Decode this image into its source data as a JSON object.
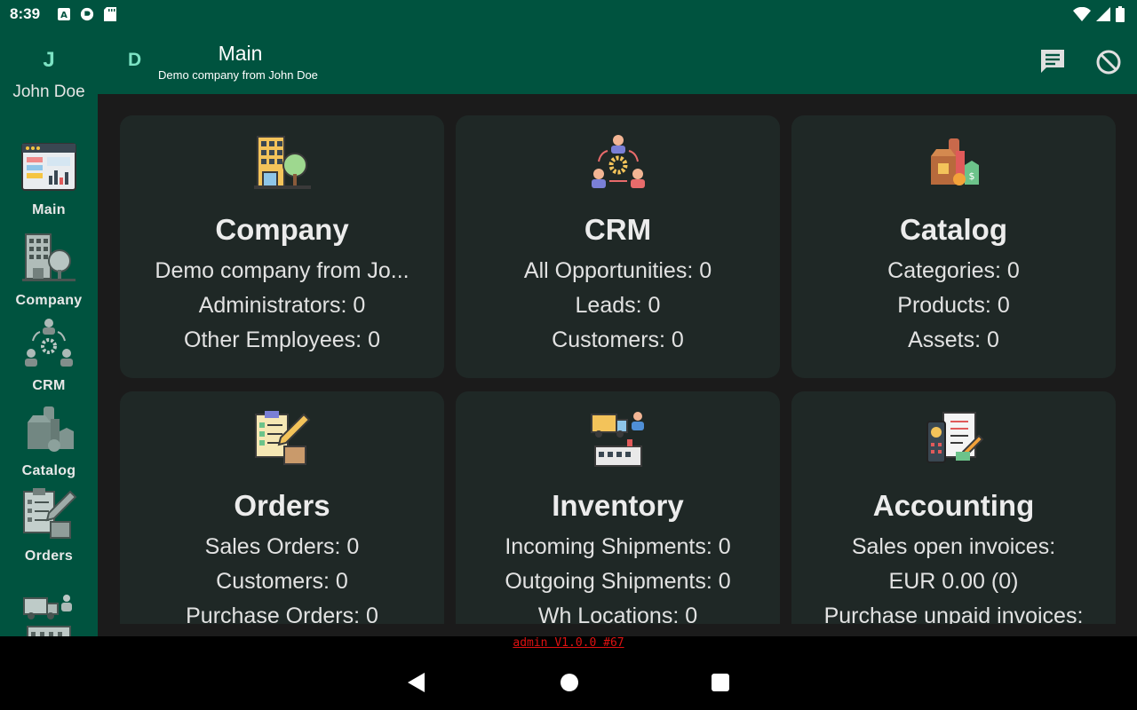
{
  "status_bar": {
    "time": "8:39"
  },
  "rail": {
    "user_initial": "J",
    "user_name": "John Doe",
    "items": [
      {
        "label": "Main",
        "icon": "dashboard-icon"
      },
      {
        "label": "Company",
        "icon": "building-icon"
      },
      {
        "label": "CRM",
        "icon": "people-network-icon"
      },
      {
        "label": "Catalog",
        "icon": "products-icon"
      },
      {
        "label": "Orders",
        "icon": "order-checklist-icon"
      },
      {
        "label": "",
        "icon": "inventory-truck-icon"
      }
    ]
  },
  "appbar": {
    "company_initial": "D",
    "title": "Main",
    "subtitle": "Demo company from John Doe",
    "chat_icon": "chat-icon",
    "block_icon": "block-icon"
  },
  "cards": [
    {
      "title": "Company",
      "icon": "building-icon",
      "lines": [
        "Demo company from Jo...",
        "Administrators: 0",
        "Other Employees: 0"
      ]
    },
    {
      "title": "CRM",
      "icon": "people-network-icon",
      "lines": [
        "All Opportunities: 0",
        "Leads: 0",
        "Customers: 0"
      ]
    },
    {
      "title": "Catalog",
      "icon": "products-icon",
      "lines": [
        "Categories: 0",
        "Products: 0",
        "Assets: 0"
      ]
    },
    {
      "title": "Orders",
      "icon": "order-checklist-icon",
      "lines": [
        "Sales Orders: 0",
        "Customers: 0",
        "Purchase Orders: 0"
      ]
    },
    {
      "title": "Inventory",
      "icon": "inventory-truck-icon",
      "lines": [
        "Incoming Shipments: 0",
        "Outgoing Shipments: 0",
        "Wh Locations: 0"
      ]
    },
    {
      "title": "Accounting",
      "icon": "invoice-calculator-icon",
      "lines": [
        "Sales open invoices:",
        "EUR 0.00 (0)",
        "Purchase unpaid invoices:"
      ]
    }
  ],
  "footer": {
    "version": "admin V1.0.0 #67"
  },
  "colors": {
    "primary": "#00533f",
    "accent": "#7ce3c4",
    "card": "#1f2826",
    "background": "#1b1b1b",
    "version_text": "#d11111"
  }
}
